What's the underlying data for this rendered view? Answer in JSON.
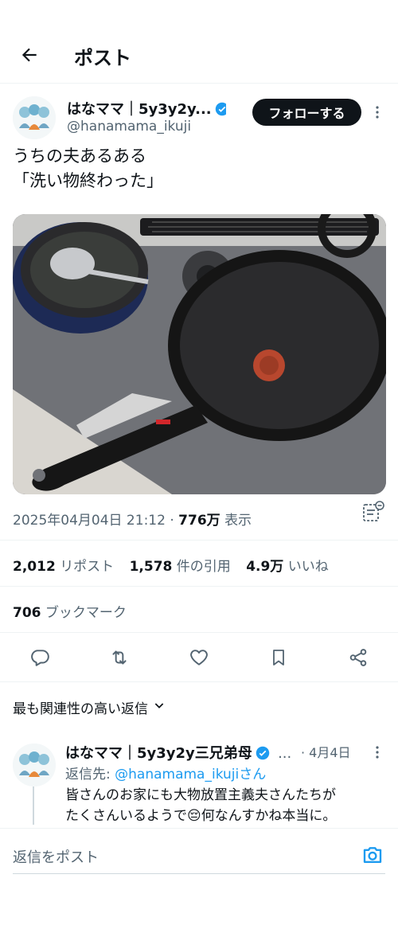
{
  "header": {
    "title": "ポスト"
  },
  "post": {
    "author_name": "はなママ｜5y3y2y...",
    "handle": "@hanamama_ikuji",
    "follow_label": "フォローする",
    "text_line1": "うちの夫あるある",
    "text_line2": "「洗い物終わった」",
    "timestamp": "2025年04月04日 21:12",
    "views_value": "776万",
    "views_label": "表示"
  },
  "stats": {
    "reposts_value": "2,012",
    "reposts_label": "リポスト",
    "quotes_value": "1,578",
    "quotes_label": "件の引用",
    "likes_value": "4.9万",
    "likes_label": "いいね",
    "bookmarks_value": "706",
    "bookmarks_label": "ブックマーク"
  },
  "sort": {
    "label": "最も関連性の高い返信"
  },
  "reply": {
    "author_name": "はなママ｜5y3y2y三兄弟母",
    "ellipsis": "...",
    "date": "· 4月4日",
    "reply_to_prefix": "返信先: ",
    "reply_to_handle": "@hanamama_ikujiさん",
    "text_line1": "皆さんのお家にも大物放置主義夫さんたちが",
    "text_line2": "たくさんいるようで😔何なんすかね本当に。"
  },
  "compose": {
    "placeholder": "返信をポスト"
  },
  "colors": {
    "accent": "#1d9bf0",
    "text": "#0f1419",
    "muted": "#536471"
  }
}
